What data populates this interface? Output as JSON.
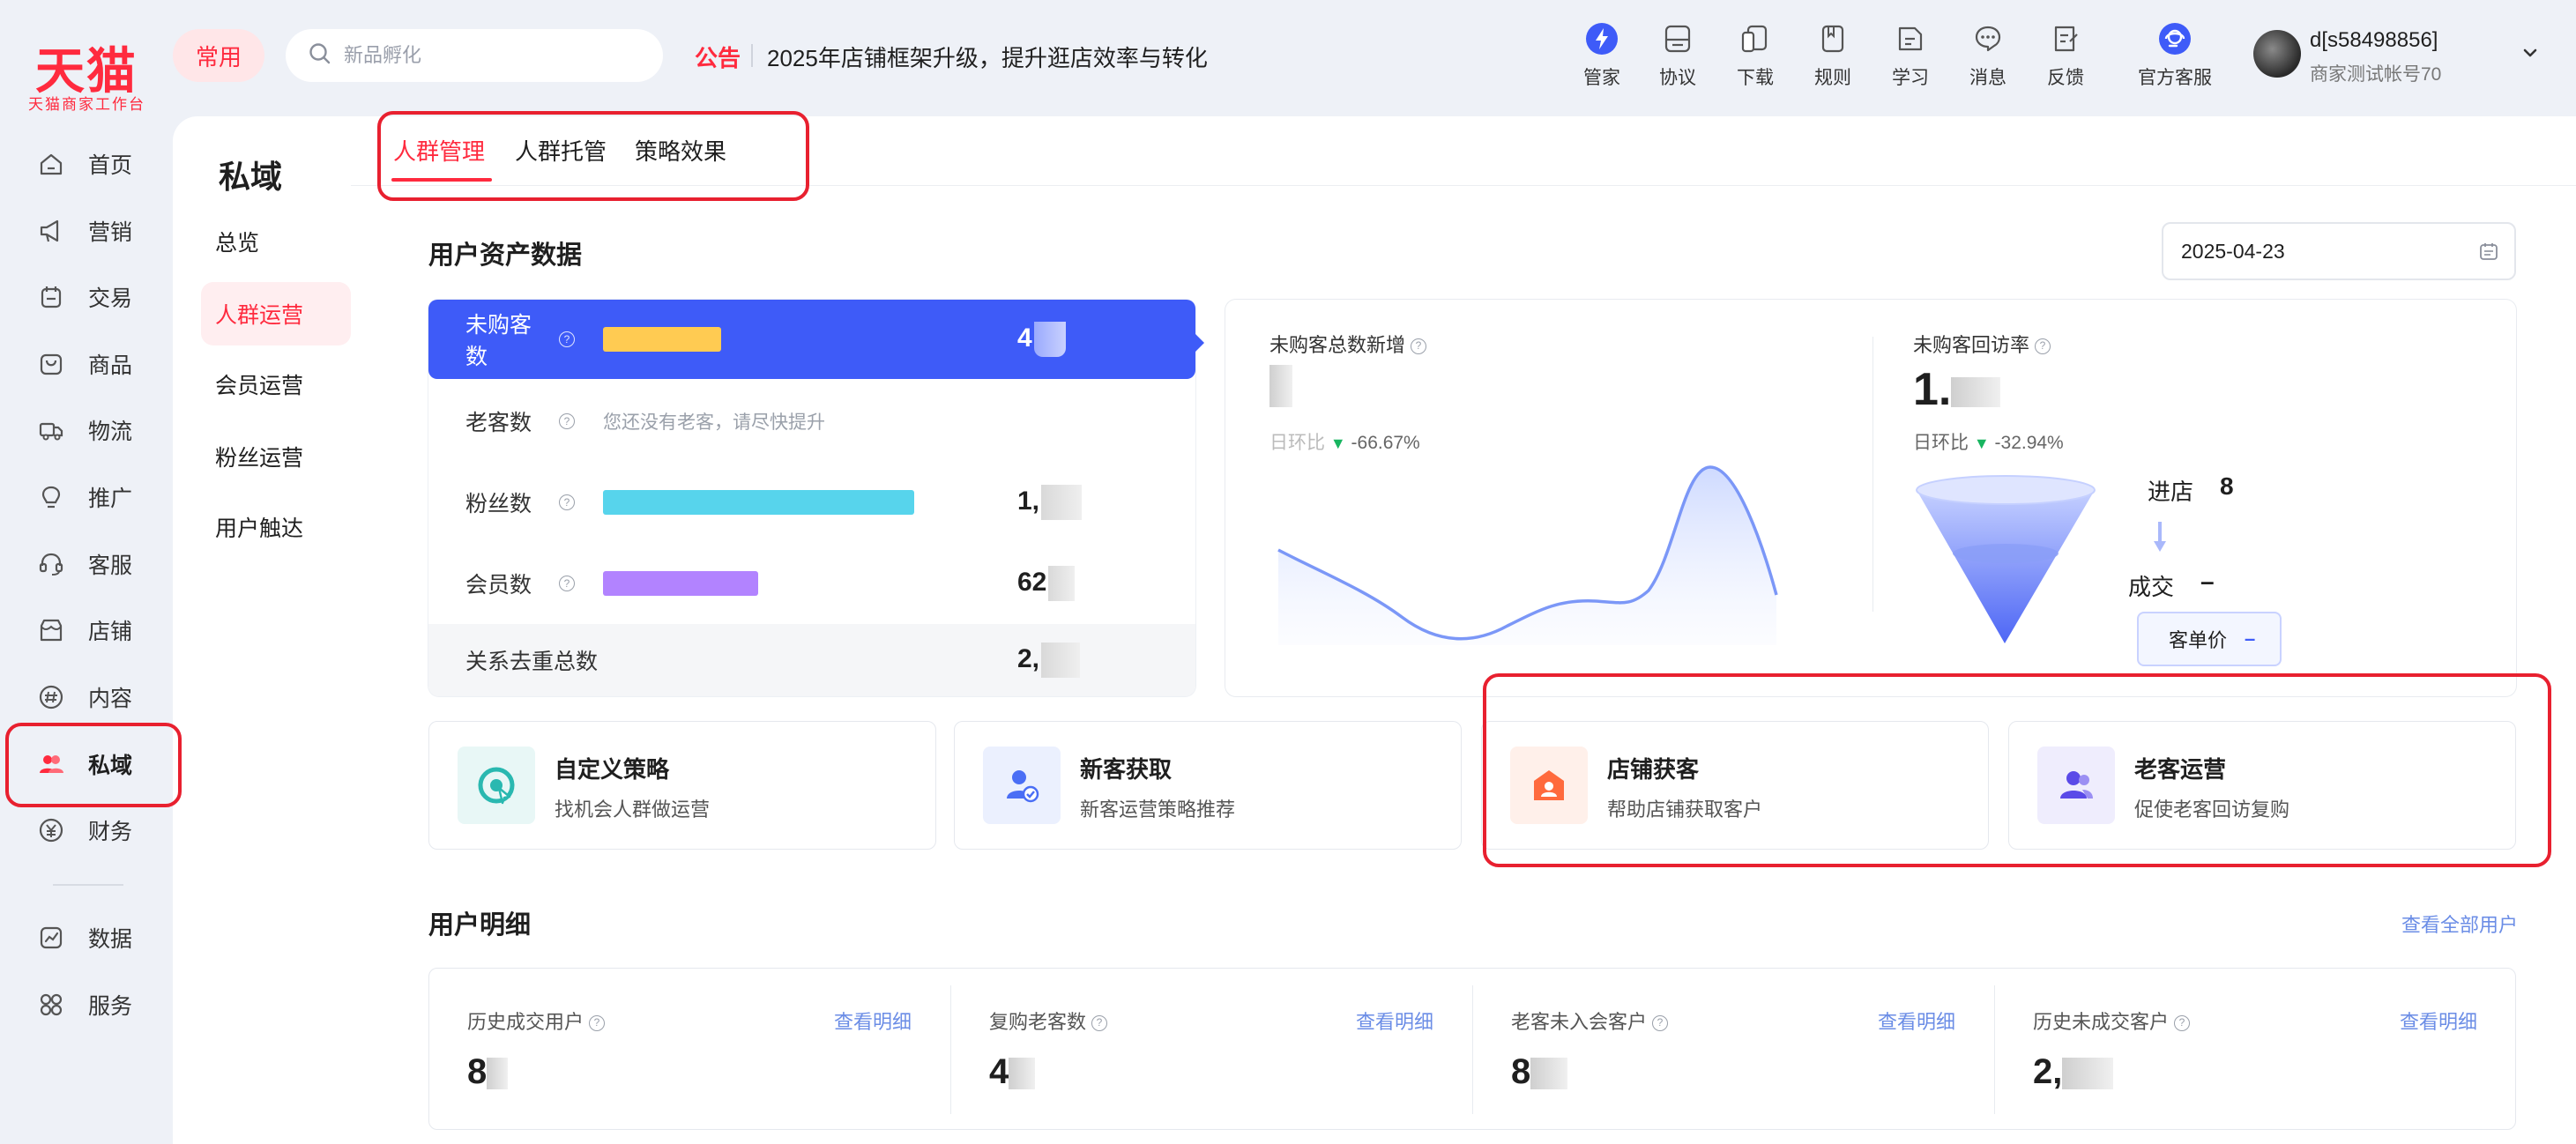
{
  "brand": {
    "logo": "天猫",
    "subtitle": "天猫商家工作台"
  },
  "topbar": {
    "common_label": "常用",
    "search_placeholder": "新品孵化",
    "notice_label": "公告",
    "notice_text": "2025年店铺框架升级，提升逛店效率与转化",
    "tools": [
      {
        "label": "管家",
        "icon": "butler-icon"
      },
      {
        "label": "协议",
        "icon": "agreement-icon"
      },
      {
        "label": "下载",
        "icon": "download-icon"
      },
      {
        "label": "规则",
        "icon": "rules-icon"
      },
      {
        "label": "学习",
        "icon": "learn-icon"
      },
      {
        "label": "消息",
        "icon": "message-icon"
      },
      {
        "label": "反馈",
        "icon": "feedback-icon"
      },
      {
        "label": "官方客服",
        "icon": "official-service-icon"
      }
    ],
    "account_id": "d[s58498856]",
    "account_name": "商家测试帐号70"
  },
  "nav": {
    "items": [
      {
        "label": "首页",
        "icon": "home-icon"
      },
      {
        "label": "营销",
        "icon": "megaphone-icon"
      },
      {
        "label": "交易",
        "icon": "trade-icon"
      },
      {
        "label": "商品",
        "icon": "goods-icon"
      },
      {
        "label": "物流",
        "icon": "truck-icon"
      },
      {
        "label": "推广",
        "icon": "bulb-icon"
      },
      {
        "label": "客服",
        "icon": "headset-icon"
      },
      {
        "label": "店铺",
        "icon": "store-icon"
      },
      {
        "label": "内容",
        "icon": "hashtag-icon"
      },
      {
        "label": "私域",
        "icon": "private-domain-icon",
        "active": true
      },
      {
        "label": "财务",
        "icon": "yen-icon"
      },
      {
        "label": "数据",
        "icon": "chart-icon"
      },
      {
        "label": "服务",
        "icon": "grid-icon"
      }
    ]
  },
  "subnav": {
    "title": "私域",
    "items": [
      "总览",
      "人群运营",
      "会员运营",
      "粉丝运营",
      "用户触达"
    ],
    "active_index": 1
  },
  "tabs": {
    "items": [
      "人群管理",
      "人群托管",
      "策略效果"
    ],
    "active_index": 0
  },
  "assets": {
    "title": "用户资产数据",
    "date": "2025-04-23",
    "metrics": [
      {
        "name": "未购客数",
        "value": "4",
        "bar_color": "#ffcb52",
        "bar_fraction": 0.16
      },
      {
        "name": "老客数",
        "hint": "您还没有老客，请尽快提升"
      },
      {
        "name": "粉丝数",
        "value": "1,",
        "bar_color": "#57d4ec",
        "bar_fraction": 0.42
      },
      {
        "name": "会员数",
        "value": "62",
        "bar_color": "#b283ff",
        "bar_fraction": 0.21
      },
      {
        "name": "关系去重总数",
        "value": "2,"
      }
    ],
    "new_total": {
      "title": "未购客总数新增",
      "change_label": "日环比",
      "change": "-66.67%"
    },
    "revisit": {
      "title": "未购客回访率",
      "value": "1.",
      "change_label": "日环比",
      "change": "-32.94%"
    },
    "funnel": {
      "enter_label": "进店",
      "enter_value": "8",
      "deal_label": "成交",
      "deal_value": "–",
      "price_label": "客单价",
      "price_value": "–"
    }
  },
  "strategies": [
    {
      "title": "自定义策略",
      "desc": "找机会人群做运营",
      "icon": "custom-strategy-icon",
      "color": "#2ab8b0",
      "bg": "#e8f7f6"
    },
    {
      "title": "新客获取",
      "desc": "新客运营策略推荐",
      "icon": "new-customer-icon",
      "color": "#4a6ef5",
      "bg": "#ebf0fe"
    },
    {
      "title": "店铺获客",
      "desc": "帮助店铺获取客户",
      "icon": "shop-acquire-icon",
      "color": "#ff6a3d",
      "bg": "#fff0ea"
    },
    {
      "title": "老客运营",
      "desc": "促使老客回访复购",
      "icon": "old-customer-icon",
      "color": "#5a4ae8",
      "bg": "#efedfd"
    }
  ],
  "details": {
    "title": "用户明细",
    "view_all": "查看全部用户",
    "link_label": "查看明细",
    "columns": [
      {
        "title": "历史成交用户",
        "value": "8"
      },
      {
        "title": "复购老客数",
        "value": "4"
      },
      {
        "title": "老客未入会客户",
        "value": "8"
      },
      {
        "title": "历史未成交客户",
        "value": "2,"
      }
    ]
  }
}
